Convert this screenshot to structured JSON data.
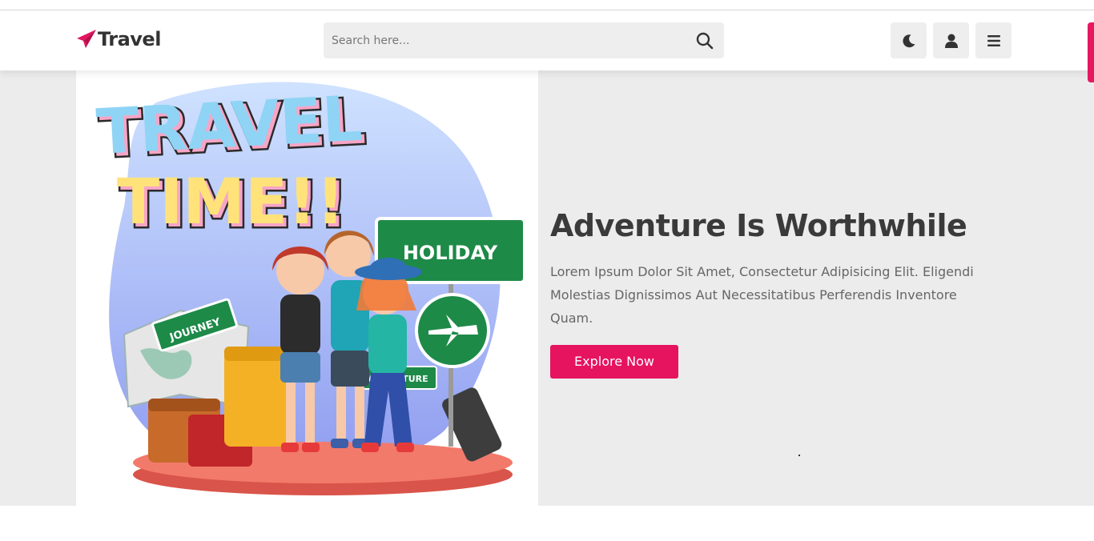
{
  "header": {
    "logo_text": "Travel",
    "search": {
      "placeholder": "Search here...",
      "value": ""
    },
    "icons": {
      "logo": "paper-plane-icon",
      "search": "search-icon",
      "theme": "moon-icon",
      "user": "user-icon",
      "menu": "hamburger-menu-icon"
    }
  },
  "hero": {
    "title": "Adventure Is Worthwhile",
    "description": "Lorem Ipsum Dolor Sit Amet, Consectetur Adipisicing Elit. Eligendi Molestias Dignissimos Aut Necessitatibus Perferendis Inventore Quam.",
    "cta_label": "Explore Now",
    "illustration": {
      "title_line1": "TRAVEL",
      "title_line2": "TIME!!",
      "sign_holiday": "HOLIDAY",
      "sign_journey": "JOURNEY",
      "sign_adventure": "ADVENTURE"
    }
  },
  "colors": {
    "accent": "#e6135f",
    "background": "#ececec",
    "text_dark": "#3a3a3a",
    "text_muted": "#666666"
  }
}
